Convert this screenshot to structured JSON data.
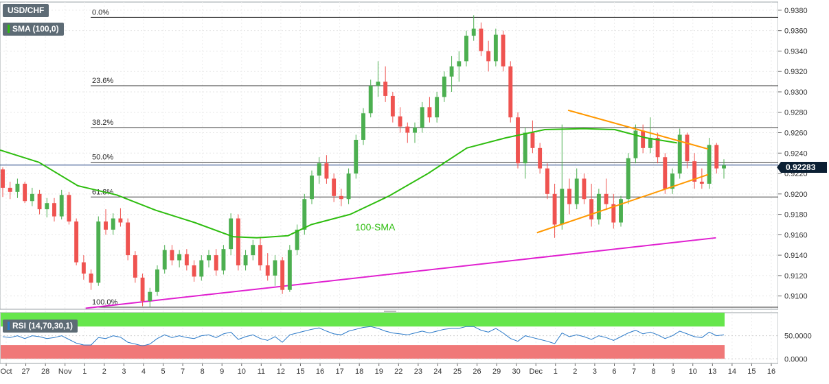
{
  "header": {
    "symbol": "USD/CHF",
    "sma_label": "SMA (100,0)",
    "rsi_label": "RSI (14,70,30,1)",
    "last_price": "0.92283"
  },
  "colors": {
    "bull_candle": "#4caf50",
    "bear_candle": "#ef5350",
    "sma": "#2ebd0f",
    "triangle": "#ff9800",
    "support": "#e020d0",
    "rsi_line": "#2878c8",
    "rsi_overbought_zone": "#66e64c",
    "rsi_oversold_zone": "#f07878"
  },
  "chart_data": [
    {
      "type": "candlestick",
      "title": "USD/CHF",
      "y_axis": {
        "ticks": [
          0.938,
          0.936,
          0.934,
          0.932,
          0.93,
          0.928,
          0.926,
          0.924,
          0.922,
          0.92,
          0.918,
          0.916,
          0.914,
          0.912,
          0.91
        ],
        "tick_labels": [
          "0.9380",
          "0.9360",
          "0.9340",
          "0.9320",
          "0.9300",
          "0.9280",
          "0.9260",
          "0.9240",
          "0.9220",
          "0.9200",
          "0.9180",
          "0.9160",
          "0.9140",
          "0.9120",
          "0.9100"
        ],
        "range": [
          0.9087,
          0.9388
        ]
      },
      "x_axis": {
        "tick_labels": [
          "Oct",
          "27",
          "28",
          "Nov",
          "1",
          "2",
          "3",
          "4",
          "5",
          "7",
          "8",
          "9",
          "10",
          "11",
          "12",
          "15",
          "16",
          "17",
          "18",
          "19",
          "22",
          "23",
          "24",
          "25",
          "26",
          "29",
          "30",
          "Dec",
          "1",
          "2",
          "3",
          "6",
          "7",
          "8",
          "9",
          "10",
          "13",
          "14",
          "15",
          "16"
        ]
      },
      "fibonacci_levels": [
        {
          "label": "0.0%",
          "price": 0.9373
        },
        {
          "label": "23.6%",
          "price": 0.9306
        },
        {
          "label": "38.2%",
          "price": 0.9265
        },
        {
          "label": "50.0%",
          "price": 0.9231
        },
        {
          "label": "61.8%",
          "price": 0.9197
        },
        {
          "label": "100.0%",
          "price": 0.9089
        }
      ],
      "last_price": 0.92283,
      "sma_100": {
        "label": "100-SMA",
        "points": [
          [
            0.0,
            0.9243
          ],
          [
            0.05,
            0.9231
          ],
          [
            0.1,
            0.9208
          ],
          [
            0.15,
            0.9199
          ],
          [
            0.2,
            0.9184
          ],
          [
            0.25,
            0.9172
          ],
          [
            0.3,
            0.9158
          ],
          [
            0.33,
            0.9157
          ],
          [
            0.37,
            0.9159
          ],
          [
            0.4,
            0.917
          ],
          [
            0.45,
            0.918
          ],
          [
            0.5,
            0.9198
          ],
          [
            0.55,
            0.922
          ],
          [
            0.6,
            0.9245
          ],
          [
            0.65,
            0.9255
          ],
          [
            0.7,
            0.9263
          ],
          [
            0.75,
            0.9264
          ],
          [
            0.79,
            0.9263
          ],
          [
            0.83,
            0.9255
          ],
          [
            0.87,
            0.925
          ]
        ]
      },
      "triangle_upper": [
        [
          0.73,
          0.9282
        ],
        [
          0.91,
          0.9244
        ]
      ],
      "triangle_lower": [
        [
          0.69,
          0.9162
        ],
        [
          0.91,
          0.9219
        ]
      ],
      "support_line": [
        [
          0.11,
          0.9088
        ],
        [
          0.92,
          0.9157
        ]
      ],
      "candles": [
        [
          0.9224,
          0.9226,
          0.9197,
          0.9206
        ],
        [
          0.9206,
          0.9212,
          0.9195,
          0.9202
        ],
        [
          0.9202,
          0.9215,
          0.9196,
          0.921
        ],
        [
          0.921,
          0.9212,
          0.9191,
          0.9193
        ],
        [
          0.9193,
          0.9206,
          0.9188,
          0.92
        ],
        [
          0.92,
          0.9204,
          0.918,
          0.9185
        ],
        [
          0.9185,
          0.9196,
          0.9177,
          0.9191
        ],
        [
          0.9191,
          0.9196,
          0.9173,
          0.9178
        ],
        [
          0.9178,
          0.9204,
          0.9175,
          0.9199
        ],
        [
          0.9199,
          0.9202,
          0.917,
          0.9173
        ],
        [
          0.9173,
          0.9176,
          0.913,
          0.9133
        ],
        [
          0.9133,
          0.914,
          0.9116,
          0.9122
        ],
        [
          0.9122,
          0.9126,
          0.9106,
          0.9113
        ],
        [
          0.9113,
          0.9178,
          0.911,
          0.9173
        ],
        [
          0.9173,
          0.9185,
          0.916,
          0.9165
        ],
        [
          0.9165,
          0.9181,
          0.916,
          0.9176
        ],
        [
          0.9176,
          0.9186,
          0.9168,
          0.9172
        ],
        [
          0.9172,
          0.9176,
          0.9135,
          0.914
        ],
        [
          0.914,
          0.9144,
          0.9113,
          0.9118
        ],
        [
          0.9118,
          0.9122,
          0.909,
          0.9095
        ],
        [
          0.9095,
          0.9108,
          0.9089,
          0.9104
        ],
        [
          0.9104,
          0.913,
          0.91,
          0.9126
        ],
        [
          0.9126,
          0.915,
          0.9122,
          0.9145
        ],
        [
          0.9145,
          0.915,
          0.913,
          0.9135
        ],
        [
          0.9135,
          0.9145,
          0.9128,
          0.9141
        ],
        [
          0.9141,
          0.9146,
          0.9125,
          0.913
        ],
        [
          0.913,
          0.9135,
          0.9114,
          0.9119
        ],
        [
          0.9119,
          0.914,
          0.9115,
          0.9135
        ],
        [
          0.9135,
          0.9145,
          0.9128,
          0.914
        ],
        [
          0.914,
          0.9146,
          0.912,
          0.9125
        ],
        [
          0.9125,
          0.915,
          0.9121,
          0.9146
        ],
        [
          0.9146,
          0.9181,
          0.914,
          0.9176
        ],
        [
          0.9176,
          0.918,
          0.9125,
          0.913
        ],
        [
          0.913,
          0.9145,
          0.9125,
          0.914
        ],
        [
          0.914,
          0.9155,
          0.9135,
          0.915
        ],
        [
          0.915,
          0.9158,
          0.9125,
          0.913
        ],
        [
          0.913,
          0.9142,
          0.9115,
          0.912
        ],
        [
          0.912,
          0.914,
          0.911,
          0.9135
        ],
        [
          0.9135,
          0.9138,
          0.9102,
          0.9106
        ],
        [
          0.9106,
          0.915,
          0.9104,
          0.9145
        ],
        [
          0.9145,
          0.917,
          0.914,
          0.9165
        ],
        [
          0.9165,
          0.92,
          0.916,
          0.9195
        ],
        [
          0.9195,
          0.9223,
          0.919,
          0.9218
        ],
        [
          0.9218,
          0.9236,
          0.921,
          0.923
        ],
        [
          0.923,
          0.9238,
          0.921,
          0.9215
        ],
        [
          0.9215,
          0.922,
          0.9192,
          0.9198
        ],
        [
          0.9198,
          0.9205,
          0.9188,
          0.9195
        ],
        [
          0.9195,
          0.9225,
          0.919,
          0.922
        ],
        [
          0.922,
          0.9258,
          0.9215,
          0.9253
        ],
        [
          0.9253,
          0.9284,
          0.9248,
          0.9279
        ],
        [
          0.9279,
          0.9312,
          0.9275,
          0.9306
        ],
        [
          0.9306,
          0.933,
          0.9295,
          0.931
        ],
        [
          0.931,
          0.9325,
          0.929,
          0.9296
        ],
        [
          0.9296,
          0.93,
          0.927,
          0.9276
        ],
        [
          0.9276,
          0.9285,
          0.926,
          0.9266
        ],
        [
          0.9266,
          0.927,
          0.925,
          0.926
        ],
        [
          0.926,
          0.927,
          0.925,
          0.9265
        ],
        [
          0.9265,
          0.929,
          0.926,
          0.9285
        ],
        [
          0.9285,
          0.9295,
          0.927,
          0.9275
        ],
        [
          0.9275,
          0.93,
          0.927,
          0.9295
        ],
        [
          0.9295,
          0.932,
          0.929,
          0.9315
        ],
        [
          0.9315,
          0.9335,
          0.93,
          0.9325
        ],
        [
          0.9325,
          0.934,
          0.931,
          0.933
        ],
        [
          0.933,
          0.936,
          0.9325,
          0.9355
        ],
        [
          0.9355,
          0.9375,
          0.935,
          0.9362
        ],
        [
          0.9362,
          0.9368,
          0.9335,
          0.934
        ],
        [
          0.934,
          0.935,
          0.932,
          0.933
        ],
        [
          0.933,
          0.9362,
          0.9325,
          0.9356
        ],
        [
          0.9356,
          0.936,
          0.932,
          0.9325
        ],
        [
          0.9325,
          0.933,
          0.927,
          0.9275
        ],
        [
          0.9275,
          0.928,
          0.9225,
          0.923
        ],
        [
          0.923,
          0.9265,
          0.9215,
          0.926
        ],
        [
          0.926,
          0.9272,
          0.924,
          0.9245
        ],
        [
          0.9245,
          0.925,
          0.922,
          0.9225
        ],
        [
          0.9225,
          0.923,
          0.9195,
          0.92
        ],
        [
          0.92,
          0.921,
          0.9157,
          0.917
        ],
        [
          0.917,
          0.9268,
          0.9165,
          0.9205
        ],
        [
          0.9205,
          0.9215,
          0.918,
          0.919
        ],
        [
          0.919,
          0.9225,
          0.9185,
          0.9215
        ],
        [
          0.9215,
          0.922,
          0.919,
          0.9195
        ],
        [
          0.9195,
          0.921,
          0.9168,
          0.9175
        ],
        [
          0.9175,
          0.9205,
          0.917,
          0.92
        ],
        [
          0.92,
          0.9215,
          0.9185,
          0.919
        ],
        [
          0.919,
          0.92,
          0.9166,
          0.9172
        ],
        [
          0.9172,
          0.9198,
          0.9168,
          0.9195
        ],
        [
          0.9195,
          0.924,
          0.919,
          0.9235
        ],
        [
          0.9235,
          0.9268,
          0.923,
          0.9262
        ],
        [
          0.9262,
          0.9268,
          0.924,
          0.9245
        ],
        [
          0.9245,
          0.9275,
          0.924,
          0.9255
        ],
        [
          0.9255,
          0.926,
          0.923,
          0.9236
        ],
        [
          0.9236,
          0.924,
          0.92,
          0.9205
        ],
        [
          0.9205,
          0.9225,
          0.92,
          0.922
        ],
        [
          0.922,
          0.9264,
          0.9215,
          0.9258
        ],
        [
          0.9258,
          0.926,
          0.9225,
          0.9232
        ],
        [
          0.9232,
          0.924,
          0.9205,
          0.9212
        ],
        [
          0.9212,
          0.9225,
          0.9205,
          0.921
        ],
        [
          0.921,
          0.9255,
          0.9205,
          0.9248
        ],
        [
          0.9248,
          0.925,
          0.922,
          0.9225
        ],
        [
          0.9225,
          0.9234,
          0.9215,
          0.9228
        ]
      ]
    },
    {
      "type": "line",
      "title": "RSI (14,70,30,1)",
      "y_axis": {
        "ticks": [
          50.0,
          0.0
        ],
        "tick_labels": [
          "50.0000",
          "0.0000"
        ],
        "range": [
          -10,
          100
        ]
      },
      "zones": {
        "overbought": [
          70,
          100
        ],
        "oversold": [
          0,
          30
        ]
      },
      "values": [
        48,
        46,
        50,
        44,
        50,
        48,
        44,
        46,
        50,
        42,
        34,
        30,
        30,
        46,
        44,
        50,
        47,
        36,
        32,
        28,
        32,
        44,
        52,
        46,
        50,
        46,
        44,
        50,
        52,
        46,
        54,
        58,
        42,
        48,
        52,
        44,
        40,
        48,
        36,
        52,
        56,
        60,
        64,
        67,
        60,
        54,
        52,
        60,
        64,
        68,
        70,
        66,
        60,
        56,
        54,
        52,
        56,
        60,
        56,
        60,
        64,
        66,
        66,
        70,
        70,
        62,
        58,
        66,
        56,
        44,
        38,
        50,
        46,
        42,
        38,
        33,
        56,
        48,
        52,
        48,
        42,
        50,
        46,
        40,
        48,
        56,
        62,
        54,
        58,
        52,
        44,
        50,
        60,
        54,
        48,
        46,
        58,
        50,
        52
      ]
    }
  ]
}
